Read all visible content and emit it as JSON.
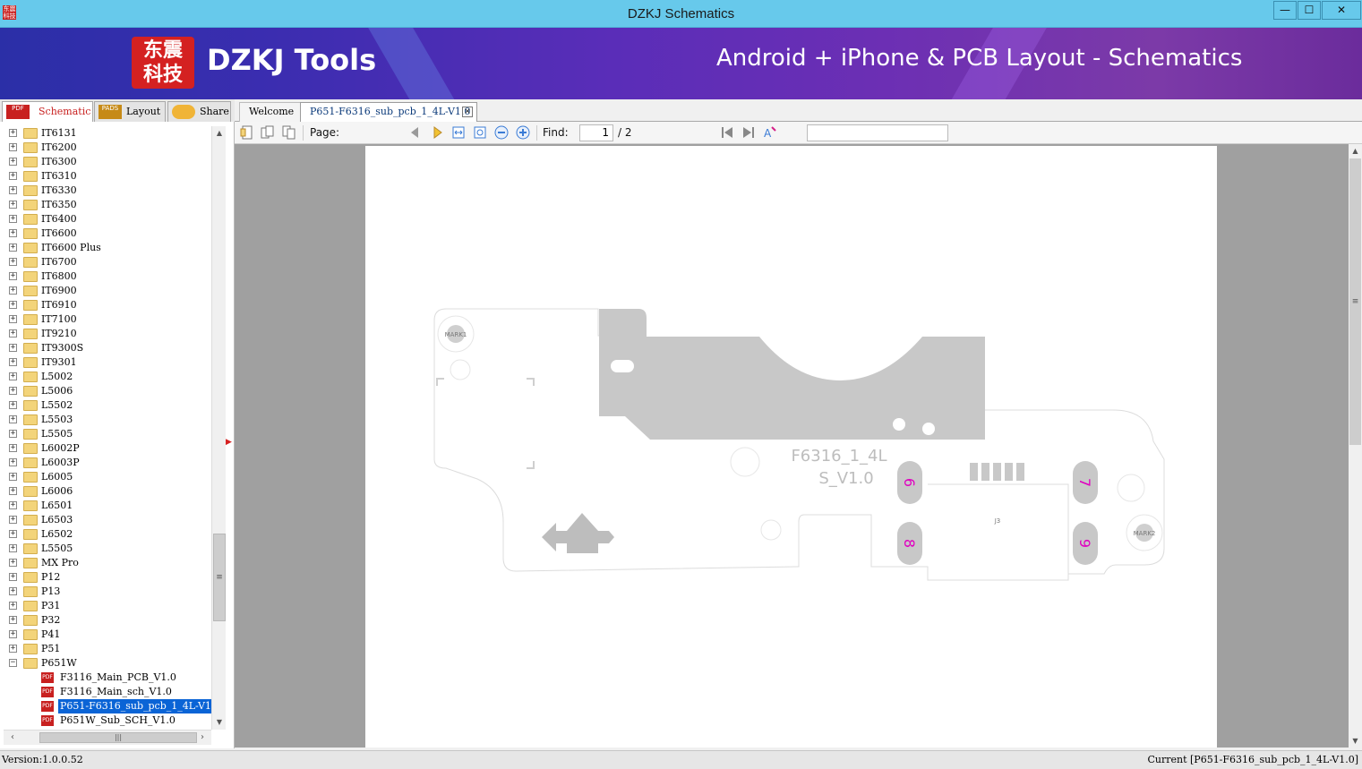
{
  "window": {
    "title": "DZKJ Schematics",
    "icon_text": "东震科技",
    "min": "—",
    "max": "☐",
    "close": "✕"
  },
  "banner": {
    "logo_text": "东震\n科技",
    "brand": "DZKJ Tools",
    "tagline": "Android + iPhone & PCB Layout - Schematics"
  },
  "left_tabs": [
    {
      "label": "Schematic",
      "icon": "PDF"
    },
    {
      "label": "Layout",
      "icon": "PADS"
    },
    {
      "label": "Share",
      "icon": "cloud-icon"
    }
  ],
  "doc_tabs": {
    "welcome": "Welcome",
    "current": "P651-F6316_sub_pcb_1_4L-V1.0",
    "close": "×"
  },
  "tree": {
    "folders": [
      "IT6131",
      "IT6200",
      "IT6300",
      "IT6310",
      "IT6330",
      "IT6350",
      "IT6400",
      "IT6600",
      "IT6600 Plus",
      "IT6700",
      "IT6800",
      "IT6900",
      "IT6910",
      "IT7100",
      "IT9210",
      "IT9300S",
      "IT9301",
      "L5002",
      "L5006",
      "L5502",
      "L5503",
      "L5505",
      "L6002P",
      "L6003P",
      "L6005",
      "L6006",
      "L6501",
      "L6503",
      "L6502",
      "L5505",
      "MX Pro",
      "P12",
      "P13",
      "P31",
      "P32",
      "P41",
      "P51"
    ],
    "open_folder": "P651W",
    "files": [
      {
        "label": "F3116_Main_PCB_V1.0",
        "selected": false
      },
      {
        "label": "F3116_Main_sch_V1.0",
        "selected": false
      },
      {
        "label": "P651-F6316_sub_pcb_1_4L-V1.0",
        "selected": true
      },
      {
        "label": "P651W_Sub_SCH_V1.0",
        "selected": false
      }
    ],
    "file_icon": "PDF"
  },
  "toolbar": {
    "page_label": "Page:",
    "page_value": "1",
    "page_total": "/ 2",
    "find_label": "Find:",
    "find_value": ""
  },
  "pcb": {
    "board_label_line1": "F6316_1_4L",
    "board_label_line2": "S_V1.0",
    "mark1": "MARK1",
    "mark2": "MARK2",
    "pad6": "6",
    "pad7": "7",
    "pad8": "8",
    "pad9": "9",
    "connector": "J3",
    "connector_pins": "1 2 3 4 5",
    "pad_color": "#e000c0",
    "copper_color": "#c8c8c8"
  },
  "status": {
    "version": "Version:1.0.0.52",
    "current": "Current [P651-F6316_sub_pcb_1_4L-V1.0]"
  }
}
